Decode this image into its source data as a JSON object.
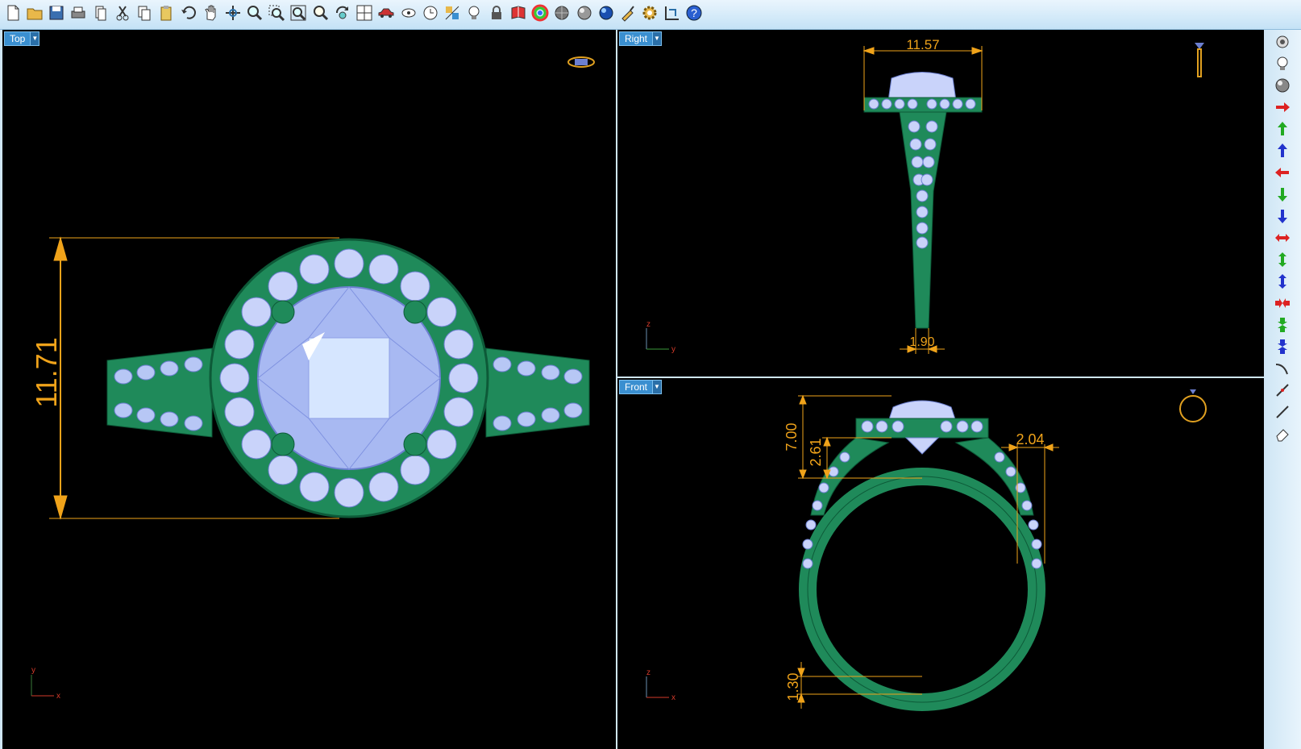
{
  "toolbar": {
    "icons": [
      "new-file-icon",
      "open-folder-icon",
      "save-icon",
      "print-icon",
      "copy-document-icon",
      "cut-icon",
      "copy-icon",
      "paste-icon",
      "undo-icon",
      "pan-hand-icon",
      "rotate-view-icon",
      "zoom-icon",
      "zoom-window-icon",
      "zoom-extents-icon",
      "zoom-selected-icon",
      "rotate-icon",
      "four-viewports-icon",
      "car-icon",
      "hide-icon",
      "clock-icon",
      "display-mode-icon",
      "light-bulb-icon",
      "lock-icon",
      "book-icon",
      "color-wheel-icon",
      "shaded-sphere-icon",
      "rendered-sphere-icon",
      "blue-sphere-icon",
      "paint-icon",
      "settings-icon",
      "dimension-icon",
      "help-icon"
    ]
  },
  "viewports": {
    "top": {
      "label": "Top",
      "dimension": "11.71",
      "axis_y": "y",
      "axis_x": "x"
    },
    "right": {
      "label": "Right",
      "dimension_top": "11.57",
      "dimension_bottom": "1.90",
      "axis_z": "z",
      "axis_y": "y"
    },
    "front": {
      "label": "Front",
      "dim_height": "7.00",
      "dim_head": "2.61",
      "dim_shank": "2.04",
      "dim_band": "1.30",
      "axis_z": "z",
      "axis_x": "x"
    }
  },
  "colors": {
    "metal": "#1f8a5a",
    "stone": "#b7c7f5",
    "dimension": "#f0a31a",
    "viewport_bg": "#000000",
    "label_bg": "#3a8fd0"
  },
  "side_toolbar": {
    "icons": [
      "camera-icon",
      "light-bulb-icon",
      "sphere-icon",
      "arrow-right-red-icon",
      "arrow-up-green-icon",
      "arrow-up-blue-icon",
      "arrow-left-red-icon",
      "arrow-down-green-icon",
      "arrow-down-blue-icon",
      "arrows-horizontal-red-icon",
      "arrows-vertical-green-icon",
      "arrows-vertical-blue-icon",
      "arrows-inward-red-icon",
      "arrows-inward-green-icon",
      "arrows-inward-blue-icon",
      "curve-icon",
      "line-icon",
      "slash-icon",
      "eraser-icon"
    ]
  }
}
